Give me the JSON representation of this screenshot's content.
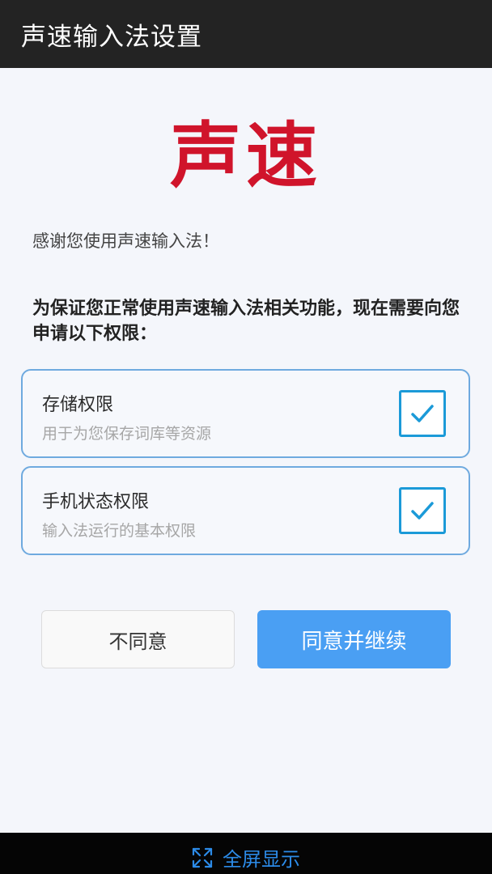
{
  "app_bar": {
    "title": "声速输入法设置"
  },
  "brand": {
    "logo_text": "声速",
    "color": "#d0142b"
  },
  "intro": {
    "thanks": "感谢您使用声速输入法！",
    "notice": "为保证您正常使用声速输入法相关功能，现在需要向您申请以下权限："
  },
  "permissions": [
    {
      "title": "存储权限",
      "description": "用于为您保存词库等资源",
      "checked": true
    },
    {
      "title": "手机状态权限",
      "description": "输入法运行的基本权限",
      "checked": true
    }
  ],
  "actions": {
    "disagree_label": "不同意",
    "agree_label": "同意并继续",
    "agree_color": "#4a9ff3"
  },
  "bottom_bar": {
    "fullscreen_label": "全屏显示",
    "icon": "expand-icon"
  }
}
